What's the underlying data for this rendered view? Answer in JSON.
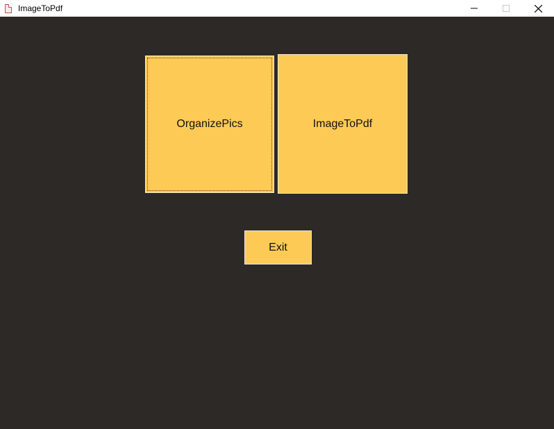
{
  "window": {
    "title": "ImageToPdf",
    "icon": "pdf-file-icon",
    "controls": [
      "minimize-icon",
      "maximize-icon",
      "close-icon"
    ]
  },
  "colors": {
    "background": "#2d2926",
    "button": "#fdca55",
    "titlebar": "#ffffff"
  },
  "buttons": {
    "organize_label": "OrganizePics",
    "imagetopdf_label": "ImageToPdf",
    "exit_label": "Exit"
  }
}
